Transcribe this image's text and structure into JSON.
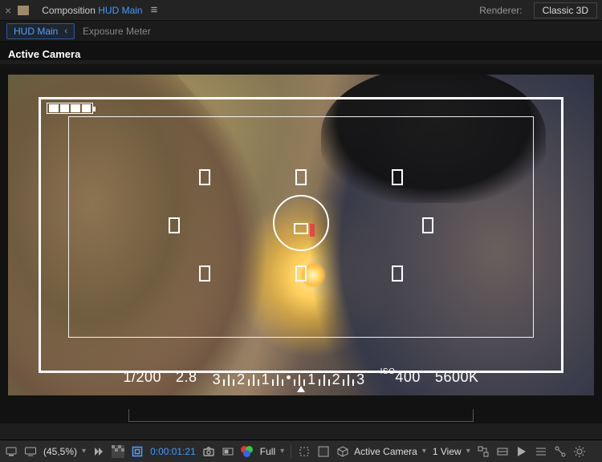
{
  "top": {
    "panel_label_prefix": "Composition",
    "panel_label_link": "HUD Main",
    "renderer_label": "Renderer:",
    "renderer_value": "Classic 3D"
  },
  "crumbs": {
    "active": "HUD Main",
    "next": "Exposure Meter"
  },
  "viewer": {
    "camera": "Active Camera"
  },
  "hud": {
    "shutter": "1/200",
    "aperture": "2.8",
    "scale_left": [
      "3",
      "2",
      "1"
    ],
    "scale_right": [
      "1",
      "2",
      "3"
    ],
    "iso_prefix": "ISO",
    "iso": "400",
    "kelvin": "5600K"
  },
  "bottom": {
    "zoom": "(45,5%)",
    "timecode": "0:00:01:21",
    "resolution": "Full",
    "camera": "Active Camera",
    "views": "1 View"
  }
}
